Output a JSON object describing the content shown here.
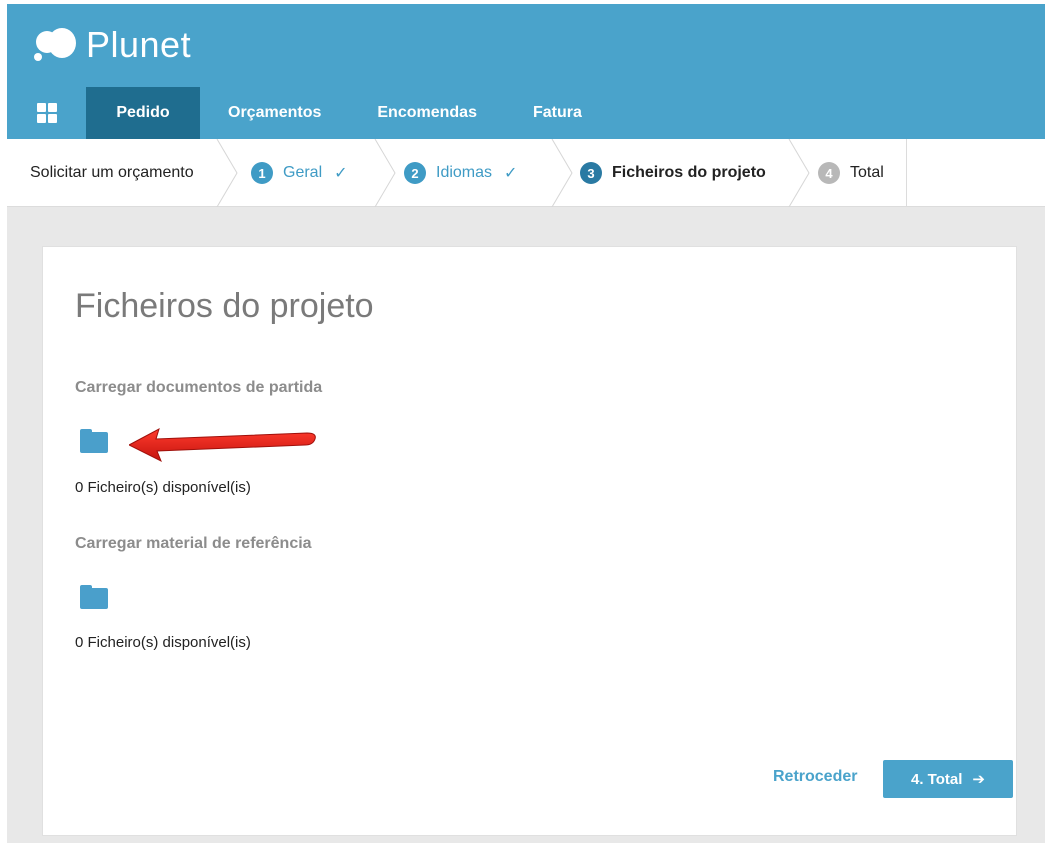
{
  "brand": {
    "name": "Plunet",
    "header_color": "#4aa3cb",
    "active_nav_color": "#1f6d8f"
  },
  "topnav": {
    "grid_icon": "grid-icon",
    "items": [
      {
        "label": "Pedido",
        "active": true
      },
      {
        "label": "Orçamentos",
        "active": false
      },
      {
        "label": "Encomendas",
        "active": false
      },
      {
        "label": "Fatura",
        "active": false
      }
    ]
  },
  "steps": {
    "intro": "Solicitar um orçamento",
    "items": [
      {
        "num": "1",
        "label": "Geral",
        "state": "done"
      },
      {
        "num": "2",
        "label": "Idiomas",
        "state": "done"
      },
      {
        "num": "3",
        "label": "Ficheiros do projeto",
        "state": "current"
      },
      {
        "num": "4",
        "label": "Total",
        "state": "upcoming"
      }
    ],
    "check_icon": "check-icon"
  },
  "main": {
    "title": "Ficheiros do projeto",
    "sections": [
      {
        "label": "Carregar documentos de partida",
        "icon": "folder-icon",
        "files": "0 Ficheiro(s) disponível(is)"
      },
      {
        "label": "Carregar material de referência",
        "icon": "folder-icon",
        "files": "0 Ficheiro(s) disponível(is)"
      }
    ],
    "annotation": {
      "icon": "red-arrow-icon",
      "color": "#e0211b"
    }
  },
  "footer": {
    "back_label": "Retroceder",
    "next_label": "4. Total",
    "next_icon": "arrow-right-icon",
    "accent": "#4aa3cb"
  }
}
